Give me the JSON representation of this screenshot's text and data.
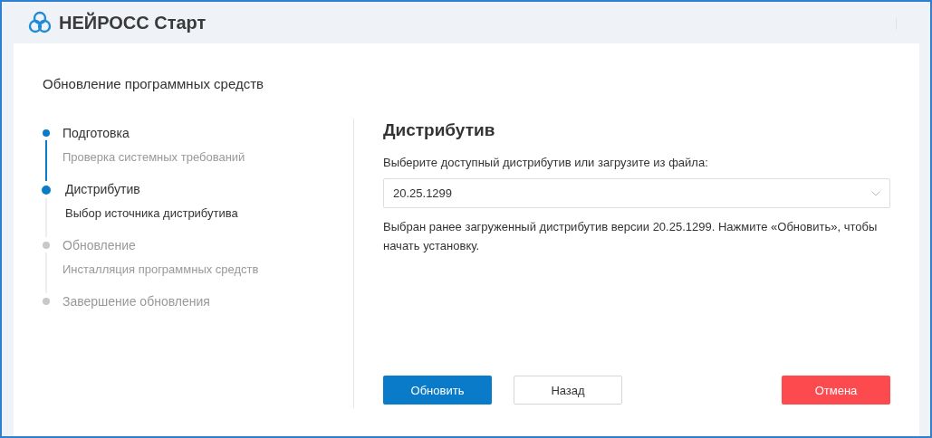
{
  "app": {
    "title": "НЕЙРОСС Старт"
  },
  "page": {
    "title": "Обновление программных средств"
  },
  "steps": [
    {
      "title": "Подготовка",
      "subtitle": "Проверка системных требований",
      "completed": true,
      "selected": false
    },
    {
      "title": "Дистрибутив",
      "subtitle": "Выбор источника дистрибутива",
      "completed": false,
      "selected": true
    },
    {
      "title": "Обновление",
      "subtitle": "Инсталляция программных средств",
      "completed": false,
      "selected": false
    },
    {
      "title": "Завершение обновления",
      "completed": false,
      "selected": false
    }
  ],
  "content": {
    "heading": "Дистрибутив",
    "prompt": "Выберите доступный дистрибутив или загрузите из файла:",
    "select": {
      "value": "20.25.1299"
    },
    "note": "Выбран ранее загруженный дистрибутив версии 20.25.1299. Нажмите «Обновить», чтобы начать установку."
  },
  "buttons": [
    {
      "label": "Обновить",
      "kind": "primary"
    },
    {
      "label": "Назад",
      "kind": "secondary"
    },
    {
      "label": "Отмена",
      "kind": "danger"
    }
  ]
}
